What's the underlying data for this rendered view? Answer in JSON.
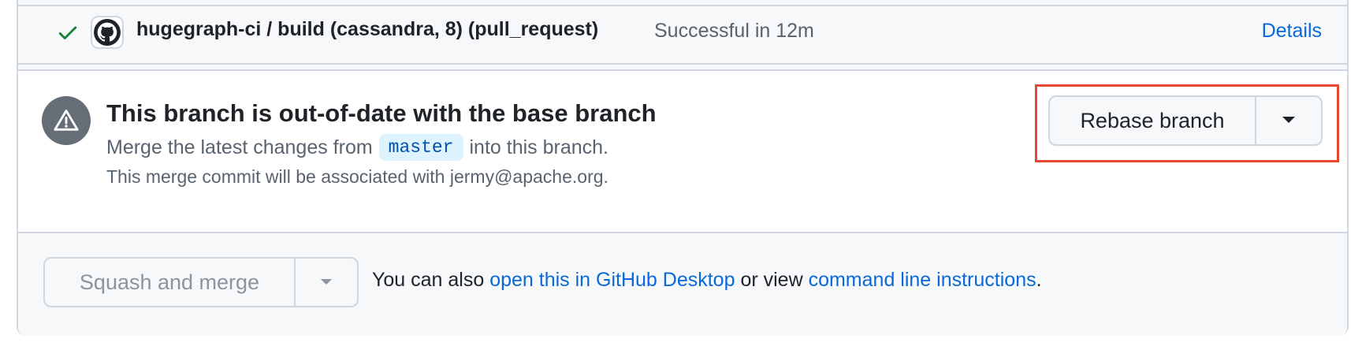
{
  "check": {
    "name": "hugegraph-ci / build (cassandra, 8) (pull_request)",
    "status": "Successful in 12m",
    "details_label": "Details"
  },
  "warning": {
    "title": "This branch is out-of-date with the base branch",
    "line1_prefix": "Merge the latest changes from",
    "branch": "master",
    "line1_suffix": "into this branch.",
    "line2": "This merge commit will be associated with jermy@apache.org."
  },
  "rebase": {
    "label": "Rebase branch"
  },
  "merge": {
    "squash_label": "Squash and merge",
    "text_prefix": "You can also",
    "desktop_link": "open this in GitHub Desktop",
    "text_middle": "or view",
    "cli_link": "command line instructions",
    "text_suffix": "."
  },
  "colors": {
    "link": "#0969da",
    "success": "#1a7f37",
    "highlight": "#e2492f",
    "muted": "#59636e"
  },
  "icons": {
    "check": "check-icon",
    "avatar": "github-octocat-icon",
    "warning": "alert-triangle-icon",
    "caret": "triangle-down-icon"
  }
}
